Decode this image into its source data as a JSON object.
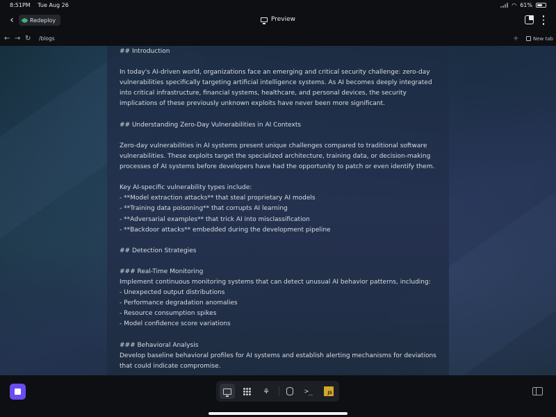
{
  "status": {
    "time": "8:51PM",
    "date": "Tue Aug 26",
    "battery": "61%",
    "battery_level": 0.61
  },
  "header": {
    "back_icon": "chevron-left-icon",
    "project_chip": "Redeploy",
    "title": "Preview",
    "tabs_icon": "tabs-icon",
    "menu_icon": "kebab-menu-icon"
  },
  "browser": {
    "url": "/blogs",
    "new_tab_label": "New tab"
  },
  "document": {
    "lines": [
      "## Introduction",
      "",
      "In today's AI-driven world, organizations face an emerging and critical security challenge: zero-day",
      "vulnerabilities specifically targeting artificial intelligence systems. As AI becomes deeply integrated",
      "into critical infrastructure, financial systems, healthcare, and personal devices, the security",
      "implications of these previously unknown exploits have never been more significant.",
      "",
      "## Understanding Zero-Day Vulnerabilities in AI Contexts",
      "",
      "Zero-day vulnerabilities in AI systems present unique challenges compared to traditional software",
      "vulnerabilities. These exploits target the specialized architecture, training data, or decision-making",
      "processes of AI systems before developers have had the opportunity to patch or even identify them.",
      "",
      "Key AI-specific vulnerability types include:",
      "- **Model extraction attacks** that steal proprietary AI models",
      "- **Training data poisoning** that corrupts AI learning",
      "- **Adversarial examples** that trick AI into misclassification",
      "- **Backdoor attacks** embedded during the development pipeline",
      "",
      "## Detection Strategies",
      "",
      "### Real-Time Monitoring",
      "Implement continuous monitoring systems that can detect unusual AI behavior patterns, including:",
      "- Unexpected output distributions",
      "- Performance degradation anomalies",
      "- Resource consumption spikes",
      "- Model confidence score variations",
      "",
      "### Behavioral Analysis",
      "Develop baseline behavioral profiles for AI systems and establish alerting mechanisms for deviations",
      "that could indicate compromise."
    ]
  },
  "dock": {
    "js_label": "JS",
    "colors": {
      "stop_button": "#6a4df0",
      "js_badge": "#d6a72a"
    }
  }
}
